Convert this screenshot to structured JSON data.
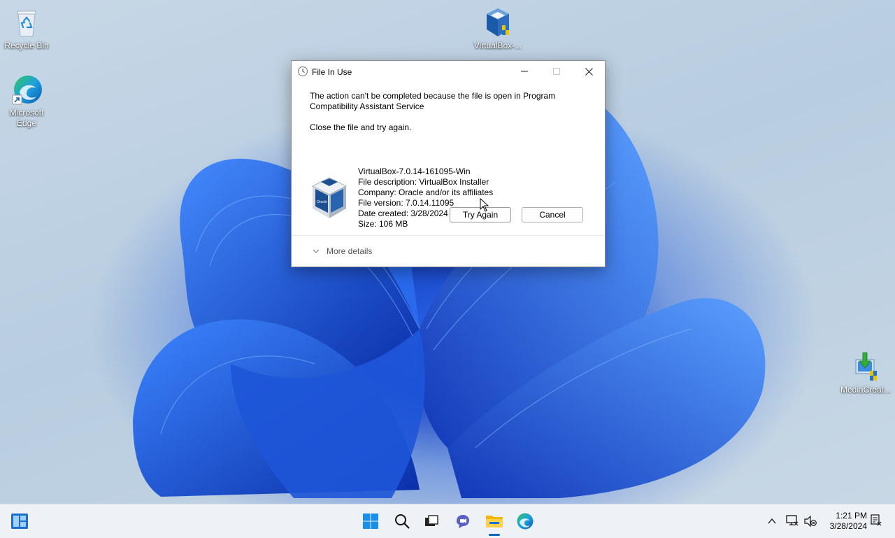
{
  "desktop": {
    "icons": [
      {
        "label": "Recycle Bin",
        "icon": "recycle-bin-icon"
      },
      {
        "label": "Microsoft Edge",
        "icon": "edge-icon"
      },
      {
        "label": "VirtualBox-...",
        "icon": "virtualbox-installer-icon"
      },
      {
        "label": "MediaCreat...",
        "icon": "media-creation-tool-icon"
      }
    ]
  },
  "dialog": {
    "title": "File In Use",
    "message": "The action can't be completed because the file is open in Program Compatibility Assistant Service",
    "instruction": "Close the file and try again.",
    "file": {
      "name": "VirtualBox-7.0.14-161095-Win",
      "description": "File description: VirtualBox Installer",
      "company": "Company: Oracle and/or its affiliates",
      "version": "File version: 7.0.14.11095",
      "date_created": "Date created: 3/28/2024 1:17 PM",
      "size": "Size: 106 MB"
    },
    "buttons": {
      "try_again": "Try Again",
      "cancel": "Cancel"
    },
    "more_details": "More details"
  },
  "taskbar": {
    "apps": [
      "widgets-icon",
      "start-icon",
      "search-icon",
      "task-view-icon",
      "chat-icon",
      "file-explorer-icon",
      "edge-icon"
    ],
    "tray": [
      "chevron-up-icon",
      "network-icon",
      "volume-muted-icon",
      "notification-icon"
    ],
    "time": "1:21 PM",
    "date": "3/28/2024"
  },
  "colors": {
    "accent": "#0067c0",
    "wallpaper_blue": "#1a47c8",
    "taskbar": "#eef1f5"
  }
}
